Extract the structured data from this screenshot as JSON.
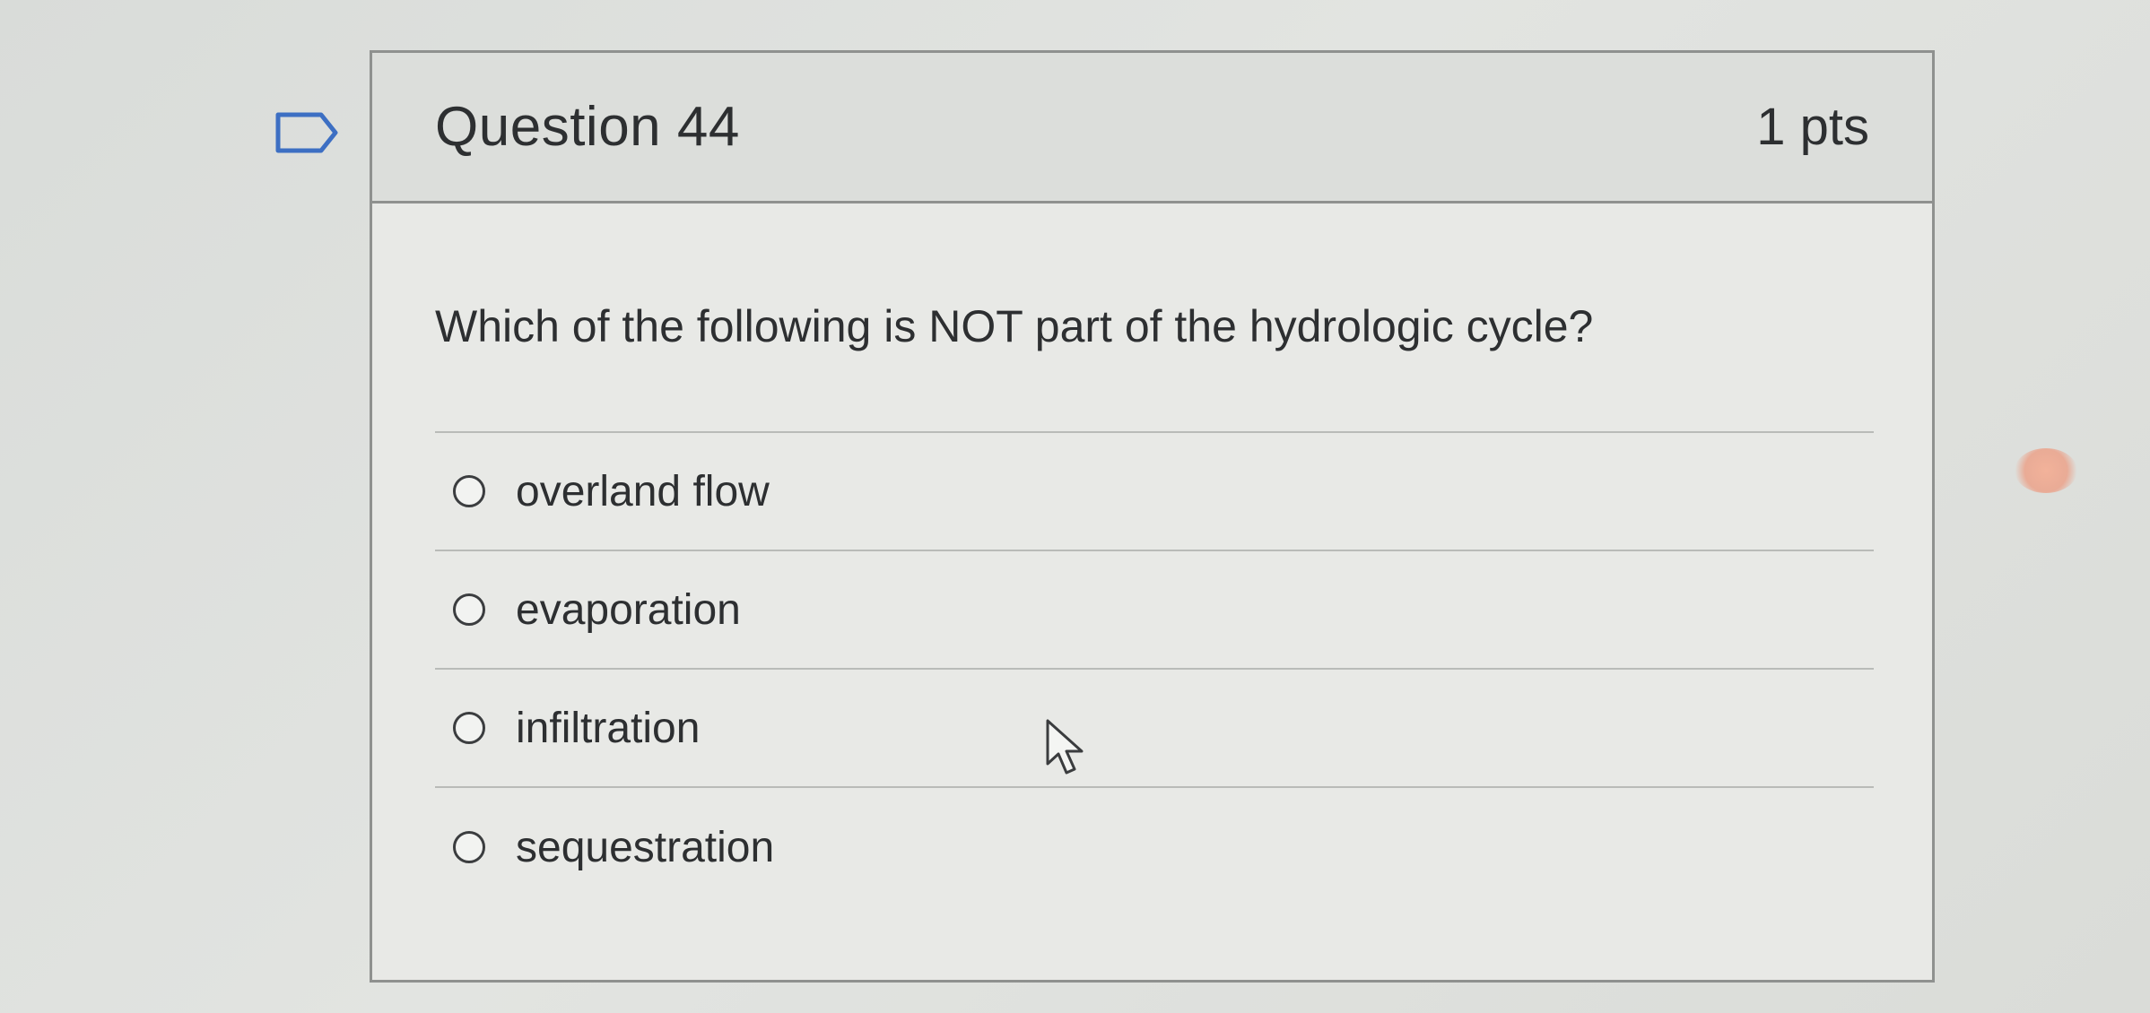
{
  "question": {
    "title": "Question 44",
    "points": "1 pts",
    "text": "Which of the following is NOT part of the hydrologic cycle?",
    "answers": [
      {
        "label": "overland flow",
        "selected": false
      },
      {
        "label": "evaporation",
        "selected": false
      },
      {
        "label": "infiltration",
        "selected": false
      },
      {
        "label": "sequestration",
        "selected": false
      }
    ]
  },
  "icons": {
    "flag": "flag-icon",
    "cursor": "mouse-pointer-icon"
  },
  "colors": {
    "text": "#2d2f31",
    "border": "#8f918f",
    "header_bg": "#dcdedb",
    "card_bg": "#e8e9e6"
  }
}
